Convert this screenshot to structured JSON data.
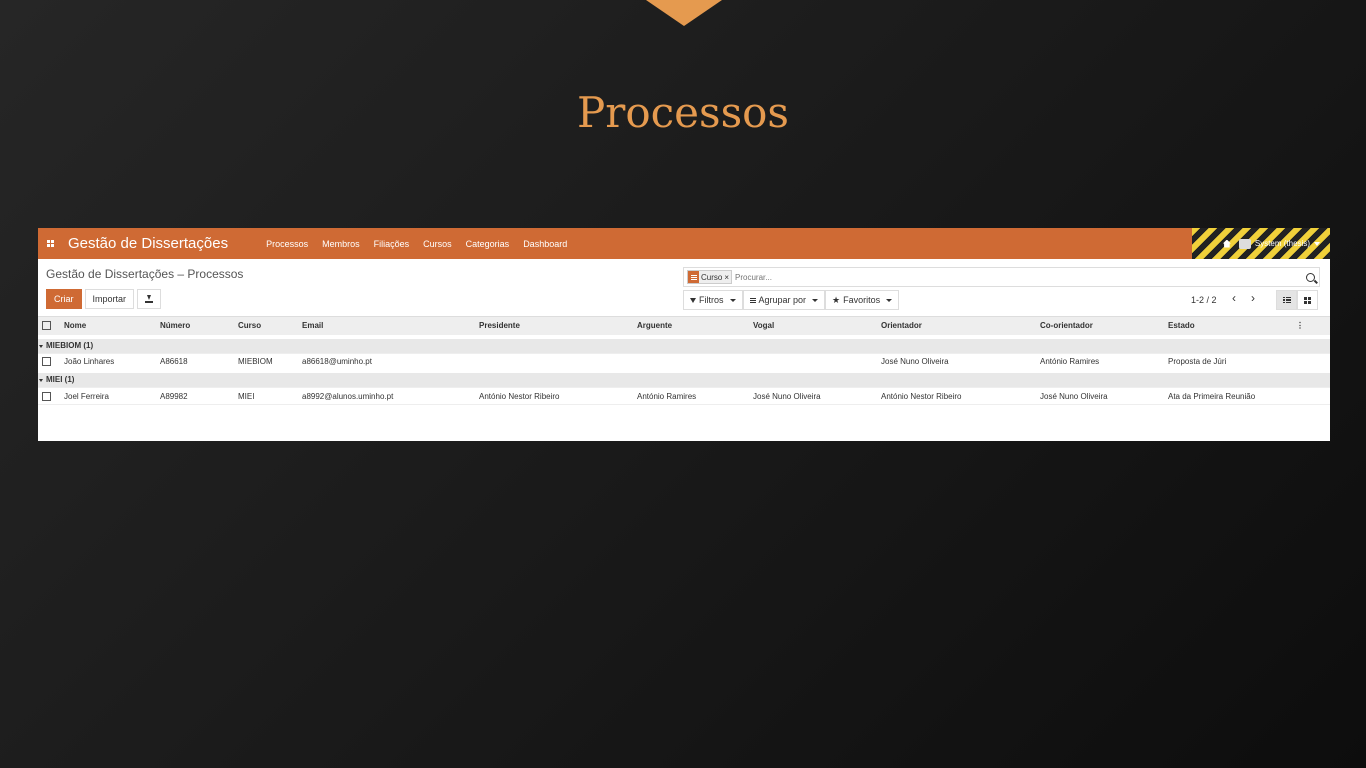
{
  "slide": {
    "title": "Processos"
  },
  "navbar": {
    "brand": "Gestão de Dissertações",
    "menu": [
      "Processos",
      "Membros",
      "Filiações",
      "Cursos",
      "Categorias",
      "Dashboard"
    ],
    "user": "System (thesis)"
  },
  "control": {
    "breadcrumb": "Gestão de Dissertações – Processos",
    "create_label": "Criar",
    "import_label": "Importar",
    "search_placeholder": "Procurar...",
    "facet_label": "Curso",
    "facet_remove": "×",
    "filters_label": "Filtros",
    "groupby_label": "Agrupar por",
    "favorites_label": "Favoritos",
    "pager": "1-2 / 2",
    "pager_prev": "‹",
    "pager_next": "›"
  },
  "table": {
    "columns": [
      "Nome",
      "Número",
      "Curso",
      "Email",
      "Presidente",
      "Arguente",
      "Vogal",
      "Orientador",
      "Co-orientador",
      "Estado"
    ],
    "groups": [
      {
        "label": "MIEBIOM (1)",
        "rows": [
          {
            "nome": "João Linhares",
            "numero": "A86618",
            "curso": "MIEBIOM",
            "email": "a86618@uminho.pt",
            "presidente": "",
            "arguente": "",
            "vogal": "",
            "orientador": "José Nuno Oliveira",
            "coorientador": "António Ramires",
            "estado": "Proposta de Júri"
          }
        ]
      },
      {
        "label": "MIEI (1)",
        "rows": [
          {
            "nome": "Joel Ferreira",
            "numero": "A89982",
            "curso": "MIEI",
            "email": "a8992@alunos.uminho.pt",
            "presidente": "António Nestor Ribeiro",
            "arguente": "António Ramires",
            "vogal": "José Nuno Oliveira",
            "orientador": "António Nestor Ribeiro",
            "coorientador": "José Nuno Oliveira",
            "estado": "Ata da Primeira Reunião"
          }
        ]
      }
    ]
  },
  "colors": {
    "accent": "#cf6a34",
    "slide_title": "#e59a4f"
  }
}
